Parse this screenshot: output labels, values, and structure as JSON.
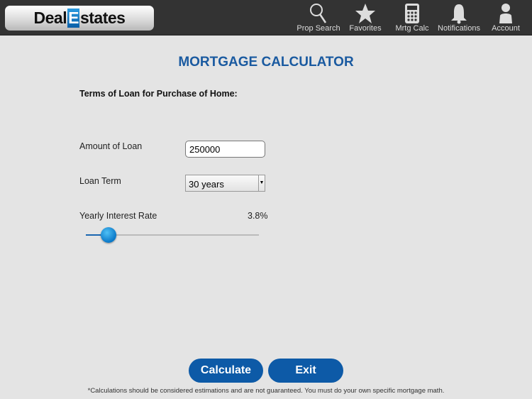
{
  "header": {
    "logo": {
      "part1": "Deal",
      "part2": "E",
      "part3": "states"
    },
    "nav": [
      {
        "label": "Prop Search",
        "icon": "search-icon"
      },
      {
        "label": "Favorites",
        "icon": "star-icon"
      },
      {
        "label": "Mrtg Calc",
        "icon": "calculator-icon"
      },
      {
        "label": "Notifications",
        "icon": "bell-icon"
      },
      {
        "label": "Account",
        "icon": "person-icon"
      }
    ]
  },
  "main": {
    "title": "MORTGAGE CALCULATOR",
    "subtitle": "Terms of Loan for Purchase of Home:",
    "amount": {
      "label": "Amount of Loan",
      "value": "250000"
    },
    "term": {
      "label": "Loan Term",
      "value": "30 years"
    },
    "rate": {
      "label": "Yearly Interest Rate",
      "value": "3.8%",
      "slider_fraction": 0.13
    },
    "calculate_label": "Calculate",
    "exit_label": "Exit",
    "disclaimer": "*Calculations should be considered estimations and are not guaranteed. You must do your own specific mortgage math."
  },
  "colors": {
    "accent": "#0d5aa7",
    "title": "#1a5aa0",
    "topbar": "#333333"
  }
}
